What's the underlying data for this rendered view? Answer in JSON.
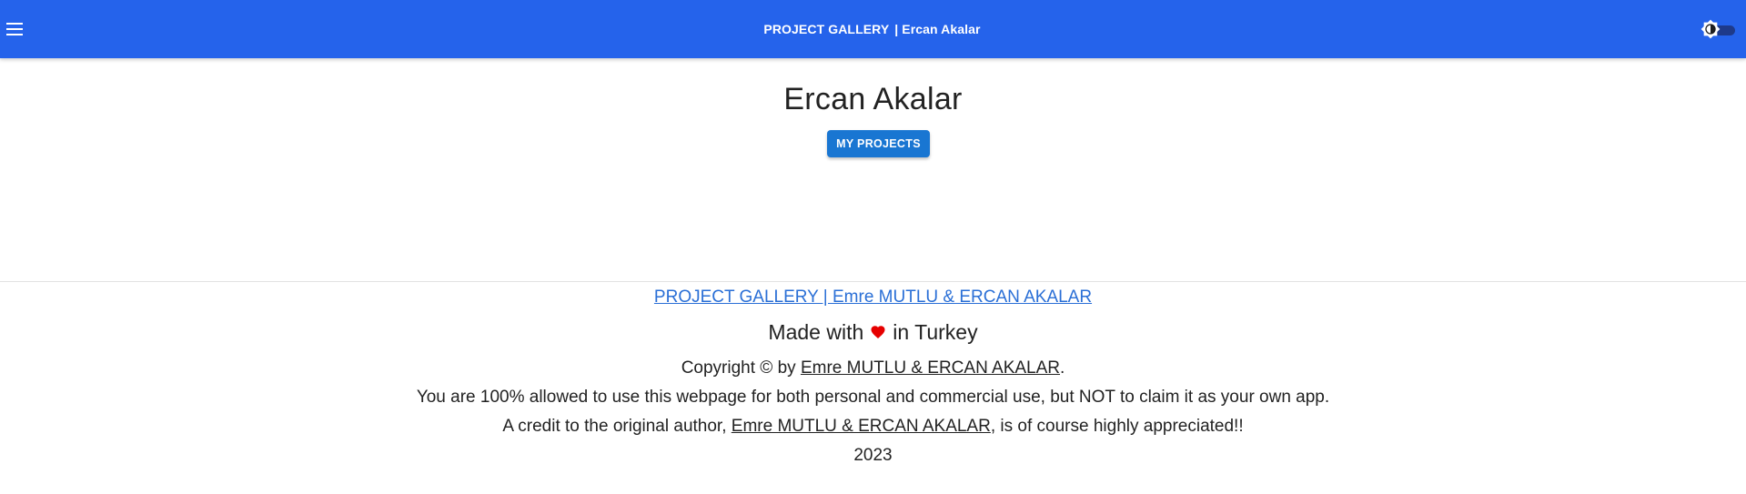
{
  "appbar": {
    "title_left": "PROJECT GALLERY",
    "title_right": "| Ercan Akalar",
    "menu_icon": "hamburger-menu-icon",
    "theme_icon": "brightness-icon",
    "bar_color": "#2563eb"
  },
  "hero": {
    "name": "Ercan Akalar",
    "button_label": "MY PROJECTS",
    "button_color": "#1976d2"
  },
  "footer": {
    "gallery_link": "PROJECT GALLERY | Emre MUTLU & ERCAN AKALAR",
    "made_with_prefix": "Made with",
    "made_with_suffix": "in Turkey",
    "heart_icon": "heart-icon",
    "heart_color": "#e60000",
    "copyright_prefix": "Copyright © by",
    "copyright_author": "Emre MUTLU & ERCAN AKALAR",
    "copyright_suffix": ".",
    "usage_text": "You are 100% allowed to use this webpage for both personal and commercial use, but NOT to claim it as your own app.",
    "credit_prefix": "A credit to the original author,",
    "credit_author": "Emre MUTLU & ERCAN AKALAR",
    "credit_suffix": ", is of course highly appreciated!!",
    "year": "2023"
  }
}
